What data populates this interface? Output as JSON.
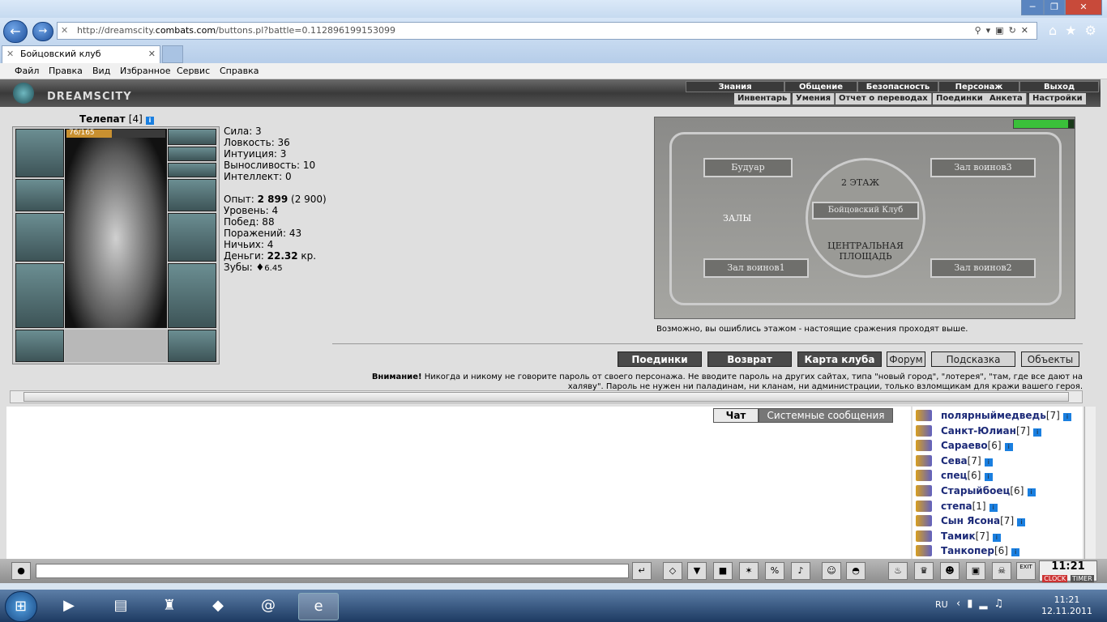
{
  "browser": {
    "url_prefix": "http://dreamscity.",
    "url_domain": "combats.com",
    "url_rest": "/buttons.pl?battle=0.112896199153099",
    "tab_title": "Бойцовский клуб",
    "menu": [
      "Файл",
      "Правка",
      "Вид",
      "Избранное",
      "Сервис",
      "Справка"
    ]
  },
  "site": {
    "logo": "DREAMSCITY",
    "topmenu": [
      "Знания",
      "Общение",
      "Безопасность",
      "Персонаж",
      "Выход"
    ],
    "submenu": [
      "Инвентарь",
      "Умения",
      "Отчет о переводах",
      "Поединки",
      "Анкета",
      "Настройки"
    ]
  },
  "character": {
    "name": "Телепат",
    "level": "[4]",
    "hp_text": "76/165",
    "hp_fraction": 0.46,
    "stats": [
      "Сила: 3",
      "Ловкость: 36",
      "Интуиция: 3",
      "Выносливость: 10",
      "Интеллект: 0"
    ],
    "exp_label": "Опыт: ",
    "exp_value": "2 899",
    "exp_next": " (2 900)",
    "level_line": "Уровень: 4",
    "wins": "Побед: 88",
    "losses": "Поражений: 43",
    "draws": "Ничьих: 4",
    "money_label": "Деньги: ",
    "money_value": "22.32",
    "money_unit": " кр.",
    "teeth": "Зубы: ",
    "teeth_value": "6.45"
  },
  "map": {
    "rooms": [
      "Будуар",
      "Зал воинов3",
      "Зал воинов1",
      "Зал воинов2"
    ],
    "floor": "2 ЭТАЖ",
    "club": "Бойцовский Клуб",
    "halls": "ЗАЛЫ",
    "square": "ЦЕНТРАЛЬНАЯ ПЛОЩАДЬ",
    "hint": "Возможно, вы ошиблись этажом - настоящие сражения проходят выше."
  },
  "buttons": [
    "Поединки",
    "Возврат",
    "Карта клуба",
    "Форум",
    "Подсказка",
    "Объекты"
  ],
  "warning": {
    "bold": "Внимание!",
    "text": " Никогда и никому не говорите пароль от своего персонажа. Не вводите пароль на других сайтах, типа \"новый город\", \"лотерея\", \"там, где все дают на халяву\". Пароль не нужен ни паладинам, ни кланам, ни администрации, только взломщикам для кражи вашего героя."
  },
  "chat": {
    "tab_chat": "Чат",
    "tab_system": "Системные сообщения"
  },
  "users": [
    {
      "name": "полярныймедведь",
      "level": "[7]"
    },
    {
      "name": "Санкт-Юлиан",
      "level": "[7]"
    },
    {
      "name": "Сараево",
      "level": "[6]"
    },
    {
      "name": "Сева",
      "level": "[7]"
    },
    {
      "name": "спец",
      "level": "[6]"
    },
    {
      "name": "Старыйбоец",
      "level": "[6]"
    },
    {
      "name": "степа",
      "level": "[1]"
    },
    {
      "name": "Сын Ясона",
      "level": "[7]"
    },
    {
      "name": "Тамик",
      "level": "[7]"
    },
    {
      "name": "Танкопер",
      "level": "[6]"
    }
  ],
  "bottom": {
    "clock_display": "11:21",
    "clock_label": "CLOCK",
    "timer_label": "TIMER",
    "exit_label": "EXIT"
  },
  "taskbar": {
    "lang": "RU",
    "time": "11:21",
    "date": "12.11.2011"
  }
}
